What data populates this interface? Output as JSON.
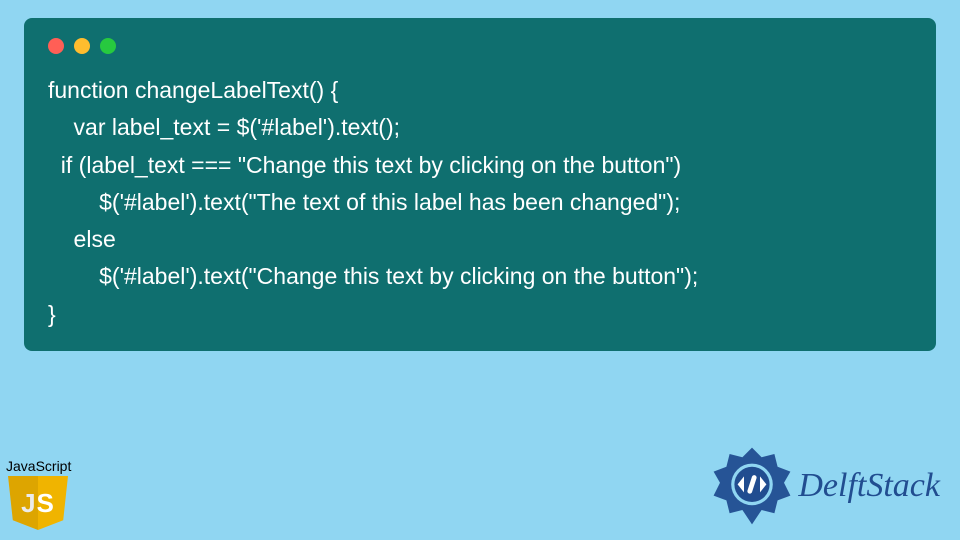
{
  "code": {
    "lines": [
      "function changeLabelText() {",
      "    var label_text = $('#label').text();",
      "  if (label_text === \"Change this text by clicking on the button\")",
      "        $('#label').text(\"The text of this label has been changed\");",
      "    else",
      "        $('#label').text(\"Change this text by clicking on the button\");",
      "}"
    ]
  },
  "window_dots": {
    "red": "#ff5f56",
    "yellow": "#ffbd2e",
    "green": "#27c93f"
  },
  "js_badge": {
    "label": "JavaScript",
    "shield_text": "JS"
  },
  "brand": {
    "name": "DelftStack",
    "logo_color": "#214d90"
  },
  "colors": {
    "page_bg": "#90d6f2",
    "panel_bg": "#0f6f6f",
    "code_fg": "#ffffff"
  }
}
